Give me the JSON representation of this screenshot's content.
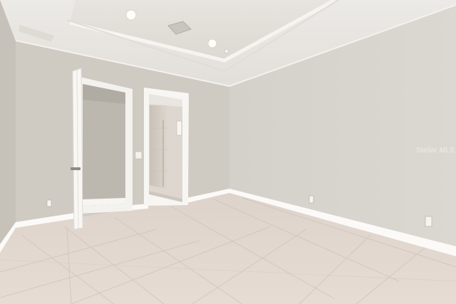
{
  "photo": {
    "subject": "empty-room-interior",
    "watermark_text": "Stellar MLS",
    "colors": {
      "wall_left": "#cfcac2",
      "wall_right": "#d6d2cc",
      "ceiling": "#e9e6e1",
      "floor": "#e2d8d0",
      "trim": "#ffffff",
      "shadow_doorway": "#bdb7ae"
    }
  }
}
